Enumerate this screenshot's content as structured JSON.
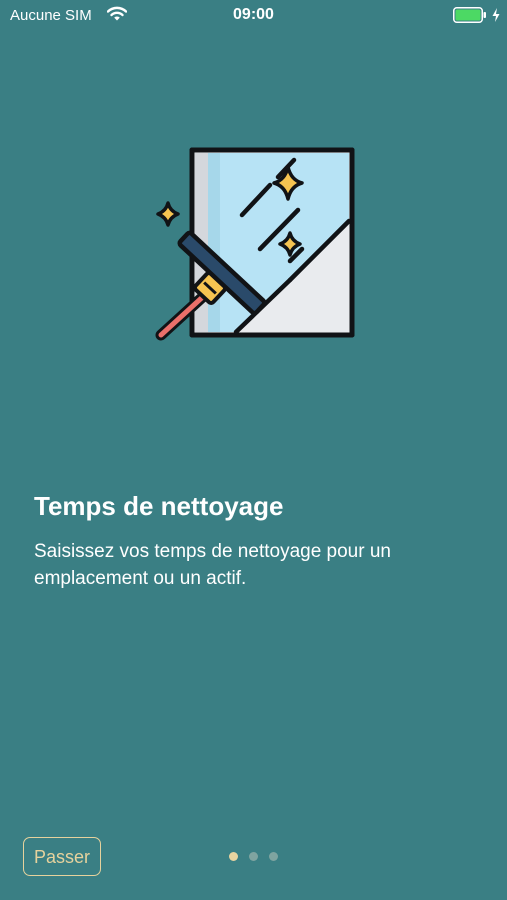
{
  "status_bar": {
    "carrier": "Aucune SIM",
    "time": "09:00",
    "battery_level": 1.0
  },
  "onboarding": {
    "illustration_icon": "window-squeegee-icon",
    "title": "Temps de nettoyage",
    "description": "Saisissez vos temps de nettoyage pour un emplacement ou un actif.",
    "skip_label": "Passer",
    "page_count": 3,
    "current_page": 1
  },
  "colors": {
    "background": "#3a7f84",
    "accent": "#e6d29d",
    "text": "#ffffff",
    "dot_inactive": "#7fa4a0"
  }
}
